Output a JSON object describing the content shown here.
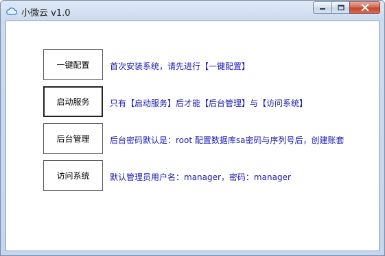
{
  "window": {
    "title": "小微云 v1.0",
    "app_icon": "cloud-icon",
    "controls": {
      "minimize_icon": "minimize-icon",
      "maximize_icon": "maximize-icon",
      "close_icon": "close-icon"
    }
  },
  "actions": [
    {
      "label": "一键配置",
      "description": "首次安装系统，请先进行【一键配置】"
    },
    {
      "label": "启动服务",
      "description": "只有【启动服务】后才能【后台管理】与【访问系统】"
    },
    {
      "label": "后台管理",
      "description": "后台密码默认是：root 配置数据库sa密码与序列号后，创建账套"
    },
    {
      "label": "访问系统",
      "description": "默认管理员用户名：manager，密码：manager"
    }
  ],
  "colors": {
    "description_text": "#1a1ab2",
    "title_bar": "#cddbef",
    "close_button": "#c1432a"
  }
}
